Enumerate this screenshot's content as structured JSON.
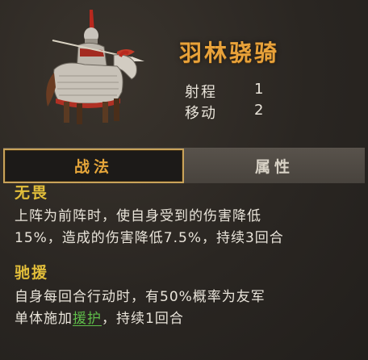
{
  "unit": {
    "name": "羽林骁骑",
    "portrait_icon": "armored-cavalry-rider",
    "stats": [
      {
        "label": "射程",
        "value": "1"
      },
      {
        "label": "移动",
        "value": "2"
      }
    ]
  },
  "tabs": [
    {
      "label": "战法",
      "active": true
    },
    {
      "label": "属性",
      "active": false
    }
  ],
  "skills": [
    {
      "name": "无畏",
      "desc_lines": [
        "上阵为前阵时，使自身受到的伤害降低",
        "15%，造成的伤害降低7.5%，持续3回合"
      ]
    },
    {
      "name": "驰援",
      "desc_line1": "自身每回合行动时，有50%概率为友军",
      "desc_line2_before": "单体施加",
      "desc_line2_keyword": "援护",
      "desc_line2_after": "，持续1回合"
    }
  ],
  "colors": {
    "title": "#e8a23a",
    "skill_name": "#e2be3a",
    "keyword": "#5fbf4a",
    "tab_active_border": "#c9a35a"
  }
}
